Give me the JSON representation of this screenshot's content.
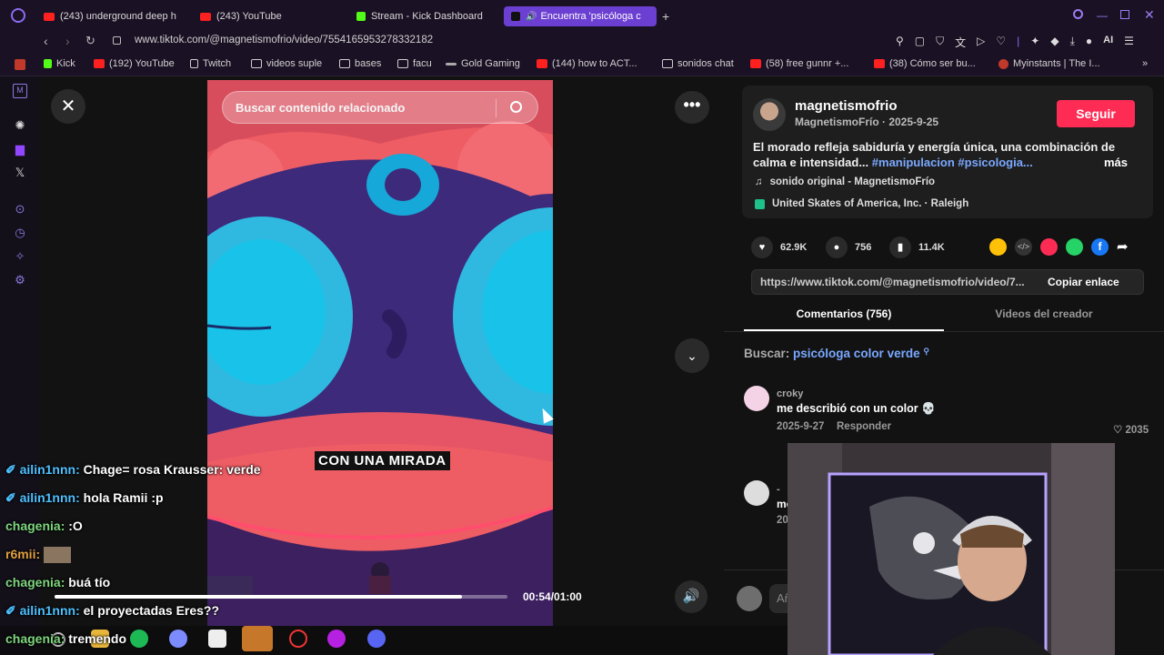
{
  "tabs": [
    {
      "label": "(243) underground deep h"
    },
    {
      "label": "(243) YouTube"
    },
    {
      "label": "Stream - Kick Dashboard"
    },
    {
      "label": "Encuentra 'psicóloga c"
    }
  ],
  "address": {
    "url": "www.tiktok.com/@magnetismofrio/video/7554165953278332182"
  },
  "toolbar": {
    "ai_label": "AI"
  },
  "bookmarks": [
    {
      "label": "Kick"
    },
    {
      "label": "(192) YouTube"
    },
    {
      "label": "Twitch"
    },
    {
      "label": "videos suple"
    },
    {
      "label": "bases"
    },
    {
      "label": "facu"
    },
    {
      "label": "Gold Gaming"
    },
    {
      "label": "(144) how to ACT..."
    },
    {
      "label": "sonidos chat"
    },
    {
      "label": "(58) free gunnr +..."
    },
    {
      "label": "(38) Cómo ser bu..."
    },
    {
      "label": "Myinstants | The I..."
    }
  ],
  "video": {
    "search_placeholder": "Buscar contenido relacionado",
    "caption": "CON UNA MIRADA",
    "time": "00:54/01:00",
    "progress": 0.9
  },
  "creator": {
    "username": "magnetismofrio",
    "meta": "MagnetismoFrío · 2025-9-25",
    "follow_label": "Seguir",
    "description": "El morado refleja sabiduría y energía única, una combinación de calma e intensidad...",
    "hashtags": "#manipulacion #psicologia...",
    "more_label": "más",
    "sound": "sonido original - MagnetismoFrío",
    "location": "United Skates of America, Inc. · Raleigh"
  },
  "stats": {
    "likes": "62.9K",
    "comments": "756",
    "saves": "11.4K"
  },
  "link": {
    "url": "https://www.tiktok.com/@magnetismofrio/video/7...",
    "copy_label": "Copiar enlace"
  },
  "panel_tabs": [
    {
      "label": "Comentarios (756)"
    },
    {
      "label": "Videos del creador"
    }
  ],
  "search_suggest": {
    "prefix": "Buscar:",
    "query": "psicóloga color verde"
  },
  "comment": {
    "user": "croky",
    "text": "me describió con un color 💀",
    "date": "2025-9-27",
    "reply_label": "Responder",
    "likes": "2035"
  },
  "comment2": {
    "user": "-",
    "text": "me",
    "date": "20"
  },
  "comment_input_placeholder": "Añ",
  "chat": [
    {
      "user": "ailin1nnn:",
      "text": "Chage= rosa Krausser: verde",
      "color": "#4ec0ff"
    },
    {
      "user": "ailin1nnn:",
      "text": "hola Ramii :p",
      "color": "#4ec0ff"
    },
    {
      "user": "chagenia:",
      "text": ":O",
      "color": "#7ed67e"
    },
    {
      "user": "r6mii:",
      "text": "",
      "color": "#e0a040"
    },
    {
      "user": "chagenia:",
      "text": "buá tío",
      "color": "#7ed67e"
    },
    {
      "user": "ailin1nnn:",
      "text": "el proyectadas Eres??",
      "color": "#4ec0ff"
    },
    {
      "user": "chagenia:",
      "text": "tremendo",
      "color": "#7ed67e"
    }
  ],
  "colors": {
    "accent": "#fe2c55",
    "hashtag": "#7aa8ff",
    "purple": "#6b3fd1"
  }
}
